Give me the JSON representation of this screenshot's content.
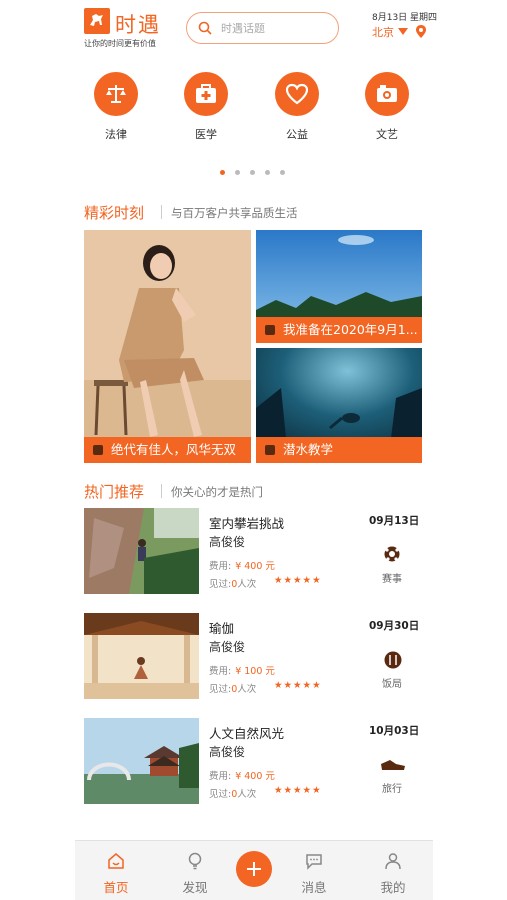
{
  "header": {
    "app_name": "时遇",
    "slogan": "让你的时间更有价值",
    "search_placeholder": "时遇话题",
    "date": "8月13日 星期四",
    "city": "北京"
  },
  "categories": [
    {
      "label": "法律",
      "icon": "scales-icon"
    },
    {
      "label": "医学",
      "icon": "medical-kit-icon"
    },
    {
      "label": "公益",
      "icon": "heart-icon"
    },
    {
      "label": "文艺",
      "icon": "camera-icon"
    }
  ],
  "carousel": {
    "page_count": 5,
    "active_index": 0
  },
  "moments": {
    "title": "精彩时刻",
    "subtitle": "与百万客户共享品质生活",
    "tiles": [
      {
        "caption": "绝代有佳人，风华无双"
      },
      {
        "caption": "我准备在2020年9月1..."
      },
      {
        "caption": "潜水教学"
      }
    ]
  },
  "hot": {
    "title": "热门推荐",
    "subtitle": "你关心的才是热门",
    "fee_label": "费用:",
    "seen_label": "见过:",
    "seen_unit": "人次",
    "items": [
      {
        "title": "室内攀岩挑战",
        "author": "高俊俊",
        "price": "¥ 400 元",
        "seen": "0",
        "rating": "★★★★★",
        "date": "09月13日",
        "tag": "赛事",
        "tag_icon": "soccer-ball-icon"
      },
      {
        "title": "瑜伽",
        "author": "高俊俊",
        "price": "¥ 100 元",
        "seen": "0",
        "rating": "★★★★★",
        "date": "09月30日",
        "tag": "饭局",
        "tag_icon": "dining-icon"
      },
      {
        "title": "人文自然风光",
        "author": "高俊俊",
        "price": "¥ 400 元",
        "seen": "0",
        "rating": "★★★★★",
        "date": "10月03日",
        "tag": "旅行",
        "tag_icon": "shoe-icon"
      }
    ]
  },
  "tabs": [
    {
      "label": "首页",
      "icon": "home-smile-icon",
      "active": true
    },
    {
      "label": "发现",
      "icon": "bulb-icon",
      "active": false
    },
    {
      "label": "消息",
      "icon": "chat-icon",
      "active": false
    },
    {
      "label": "我的",
      "icon": "user-icon",
      "active": false
    }
  ],
  "colors": {
    "accent": "#f26522"
  }
}
